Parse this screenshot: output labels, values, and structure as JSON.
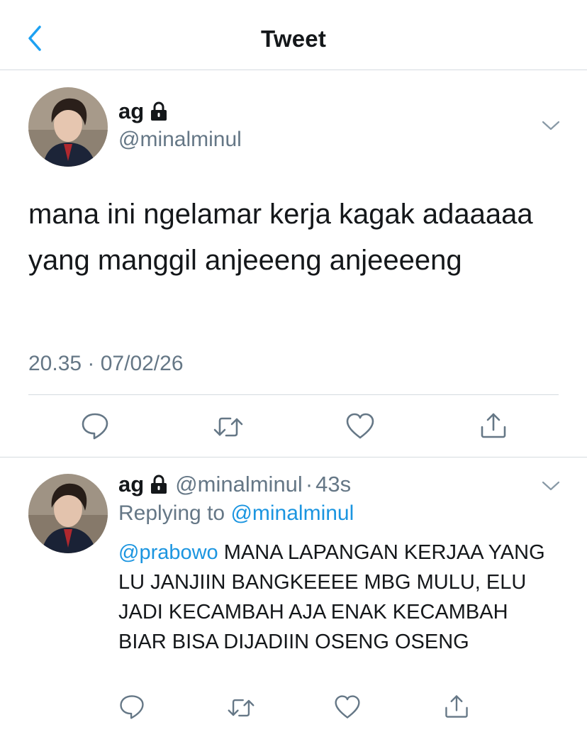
{
  "header": {
    "title": "Tweet",
    "back_icon": "chevron-left-icon"
  },
  "tweet": {
    "name": "ag",
    "handle": "@minalminul",
    "text": "mana ini ngelamar kerja kagak adaaaaa yang manggil anjeeeng anjeeeeng",
    "timestamp": "20.35 · 07/02/26",
    "actions": [
      "reply-icon",
      "retweet-icon",
      "like-icon",
      "share-icon"
    ]
  },
  "reply": {
    "name": "ag",
    "handle": "@minalminul",
    "separator": "·",
    "time": "43s",
    "replying_label": "Replying to",
    "replying_to": "@minalminul",
    "mention": "@prabowo",
    "text": "MANA LAPANGAN KERJAA YANG LU JANJIIN BANGKEEEE MBG MULU, ELU JADI KECAMBAH AJA ENAK KECAMBAH BIAR BISA DIJADIIN OSENG OSENG",
    "actions": [
      "reply-icon",
      "retweet-icon",
      "like-icon",
      "share-icon"
    ]
  },
  "colors": {
    "accent": "#1b95e0",
    "secondary_text": "#657786",
    "divider": "#d5dbe0"
  }
}
